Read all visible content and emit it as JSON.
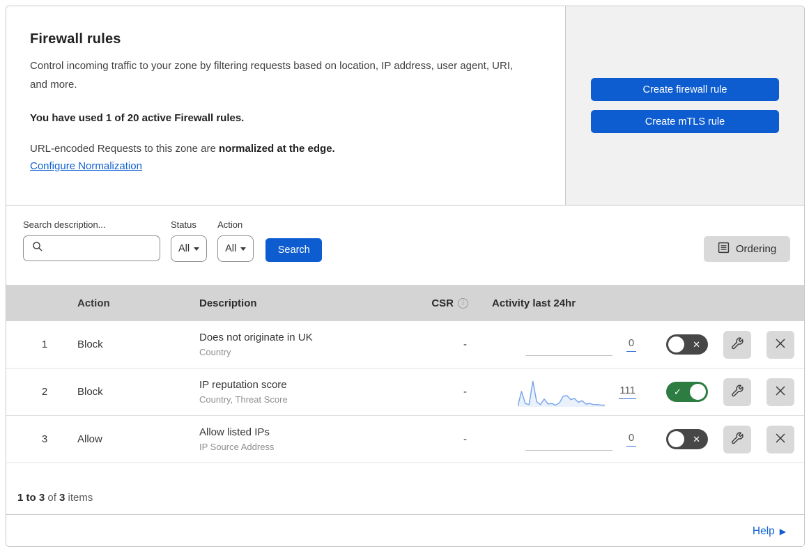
{
  "header": {
    "title": "Firewall rules",
    "description": "Control incoming traffic to your zone by filtering requests based on location, IP address, user agent, URI, and more.",
    "usage_bold": "You have used 1 of 20 active Firewall rules.",
    "normalization_prefix": "URL-encoded Requests to this zone are ",
    "normalization_bold": "normalized at the edge.",
    "normalization_link": "Configure Normalization",
    "create_firewall_button": "Create firewall rule",
    "create_mtls_button": "Create mTLS rule"
  },
  "filters": {
    "search_label": "Search description...",
    "status_label": "Status",
    "status_value": "All",
    "action_label": "Action",
    "action_value": "All",
    "search_button": "Search",
    "ordering_button": "Ordering"
  },
  "table": {
    "columns": {
      "action": "Action",
      "description": "Description",
      "csr": "CSR",
      "activity": "Activity last 24hr"
    },
    "rows": [
      {
        "number": "1",
        "action": "Block",
        "description": "Does not originate in UK",
        "fields": "Country",
        "csr": "-",
        "activity_count": "0",
        "enabled": false,
        "sparkline": null
      },
      {
        "number": "2",
        "action": "Block",
        "description": "IP reputation score",
        "fields": "Country, Threat Score",
        "csr": "-",
        "activity_count": "111",
        "enabled": true,
        "sparkline": [
          2,
          55,
          12,
          8,
          92,
          18,
          8,
          28,
          10,
          12,
          6,
          14,
          38,
          40,
          26,
          30,
          16,
          22,
          10,
          12,
          8,
          8,
          6,
          6
        ]
      },
      {
        "number": "3",
        "action": "Allow",
        "description": "Allow listed IPs",
        "fields": "IP Source Address",
        "csr": "-",
        "activity_count": "0",
        "enabled": false,
        "sparkline": null
      }
    ]
  },
  "footer": {
    "range_bold": "1 to 3",
    "of_text": " of ",
    "total_bold": "3",
    "items_text": " items",
    "help_label": "Help"
  },
  "colors": {
    "primary_blue": "#0d5cd0",
    "link_blue": "#1061d1",
    "toggle_on_green": "#2d7d43",
    "toggle_off_gray": "#474747",
    "panel_gray": "#f1f1f1",
    "table_header_gray": "#d4d4d4",
    "sparkline_blue": "#7aa7e9"
  }
}
